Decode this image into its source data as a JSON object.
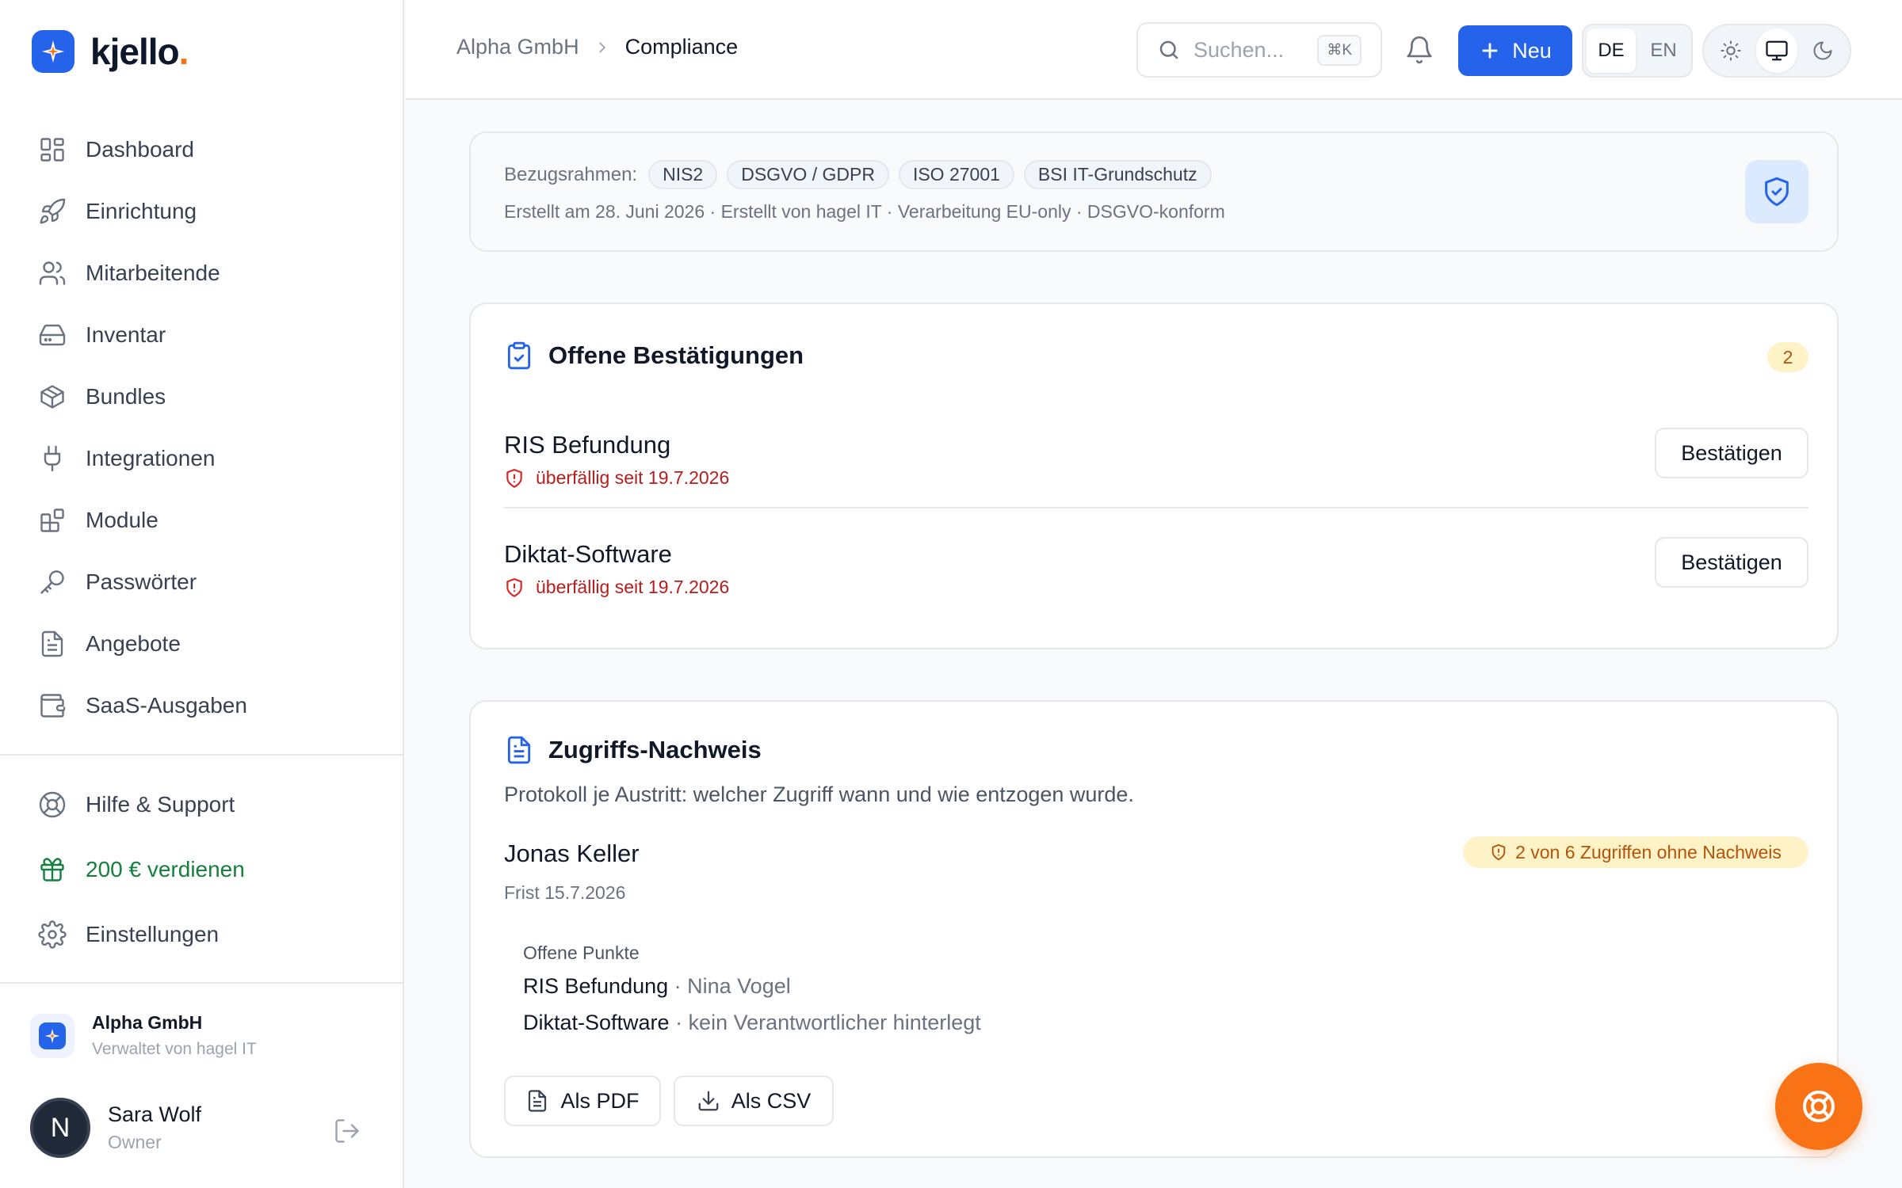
{
  "brand": {
    "name": "kjello",
    "dot": ".",
    "accent": "#2563eb",
    "dot_color": "#f97316"
  },
  "sidebar": {
    "items": [
      {
        "label": "Dashboard",
        "icon": "dashboard-icon"
      },
      {
        "label": "Einrichtung",
        "icon": "rocket-icon"
      },
      {
        "label": "Mitarbeitende",
        "icon": "users-icon"
      },
      {
        "label": "Inventar",
        "icon": "hard-drive-icon"
      },
      {
        "label": "Bundles",
        "icon": "package-icon"
      },
      {
        "label": "Integrationen",
        "icon": "plug-icon"
      },
      {
        "label": "Module",
        "icon": "blocks-icon"
      },
      {
        "label": "Passwörter",
        "icon": "key-icon"
      },
      {
        "label": "Angebote",
        "icon": "file-icon"
      },
      {
        "label": "SaaS-Ausgaben",
        "icon": "wallet-icon"
      }
    ],
    "bottom": [
      {
        "label": "Hilfe & Support",
        "icon": "lifebuoy-icon"
      },
      {
        "label": "200 € verdienen",
        "icon": "gift-icon"
      },
      {
        "label": "Einstellungen",
        "icon": "gear-icon"
      }
    ],
    "org": {
      "name": "Alpha GmbH",
      "sub": "Verwaltet von hagel IT"
    },
    "user": {
      "initial": "N",
      "name": "Sara Wolf",
      "role": "Owner"
    }
  },
  "header": {
    "breadcrumb": [
      "Alpha GmbH",
      "Compliance"
    ],
    "search_placeholder": "Suchen...",
    "search_shortcut": "⌘K",
    "new_label": "Neu",
    "languages": [
      "DE",
      "EN"
    ],
    "active_language": "DE"
  },
  "frameworks": {
    "label": "Bezugsrahmen:",
    "chips": [
      "NIS2",
      "DSGVO / GDPR",
      "ISO 27001",
      "BSI IT-Grundschutz"
    ],
    "meta": "Erstellt am 28. Juni 2026 · Erstellt von hagel IT · Verarbeitung EU-only · DSGVO-konform"
  },
  "confirmations": {
    "title": "Offene Bestätigungen",
    "count": "2",
    "items": [
      {
        "name": "RIS Befundung",
        "due": "überfällig seit 19.7.2026",
        "action": "Bestätigen"
      },
      {
        "name": "Diktat-Software",
        "due": "überfällig seit 19.7.2026",
        "action": "Bestätigen"
      }
    ]
  },
  "access": {
    "title": "Zugriffs-Nachweis",
    "description": "Protokoll je Austritt: welcher Zugriff wann und wie entzogen wurde.",
    "person": "Jonas Keller",
    "deadline": "Frist 15.7.2026",
    "warning": "2 von 6 Zugriffen ohne Nachweis",
    "open_title": "Offene Punkte",
    "open_items": [
      {
        "name": "RIS Befundung",
        "detail": " · Nina Vogel"
      },
      {
        "name": "Diktat-Software",
        "detail": " · kein Verantwortlicher hinterlegt"
      }
    ],
    "export_pdf": "Als PDF",
    "export_csv": "Als CSV"
  }
}
